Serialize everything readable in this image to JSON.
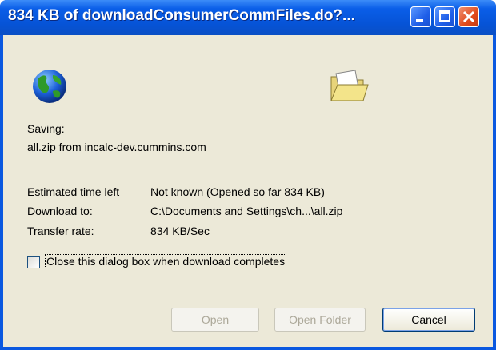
{
  "window": {
    "title": "834 KB of downloadConsumerCommFiles.do?..."
  },
  "icons": {
    "globe": "globe-icon",
    "folder": "open-folder-icon"
  },
  "status": {
    "saving_label": "Saving:",
    "file_source": "all.zip from incalc-dev.cummins.com"
  },
  "details": {
    "time_label": "Estimated time left",
    "time_value": "Not known (Opened so far 834 KB)",
    "dest_label": "Download to:",
    "dest_value": "C:\\Documents and Settings\\ch...\\all.zip",
    "rate_label": "Transfer rate:",
    "rate_value": "834 KB/Sec"
  },
  "checkbox": {
    "label": "Close this dialog box when download completes",
    "checked": false
  },
  "buttons": {
    "open": "Open",
    "open_folder": "Open Folder",
    "cancel": "Cancel"
  },
  "colors": {
    "titlebar": "#0a5ee8",
    "face": "#ece9d8",
    "close": "#e04a1c"
  }
}
